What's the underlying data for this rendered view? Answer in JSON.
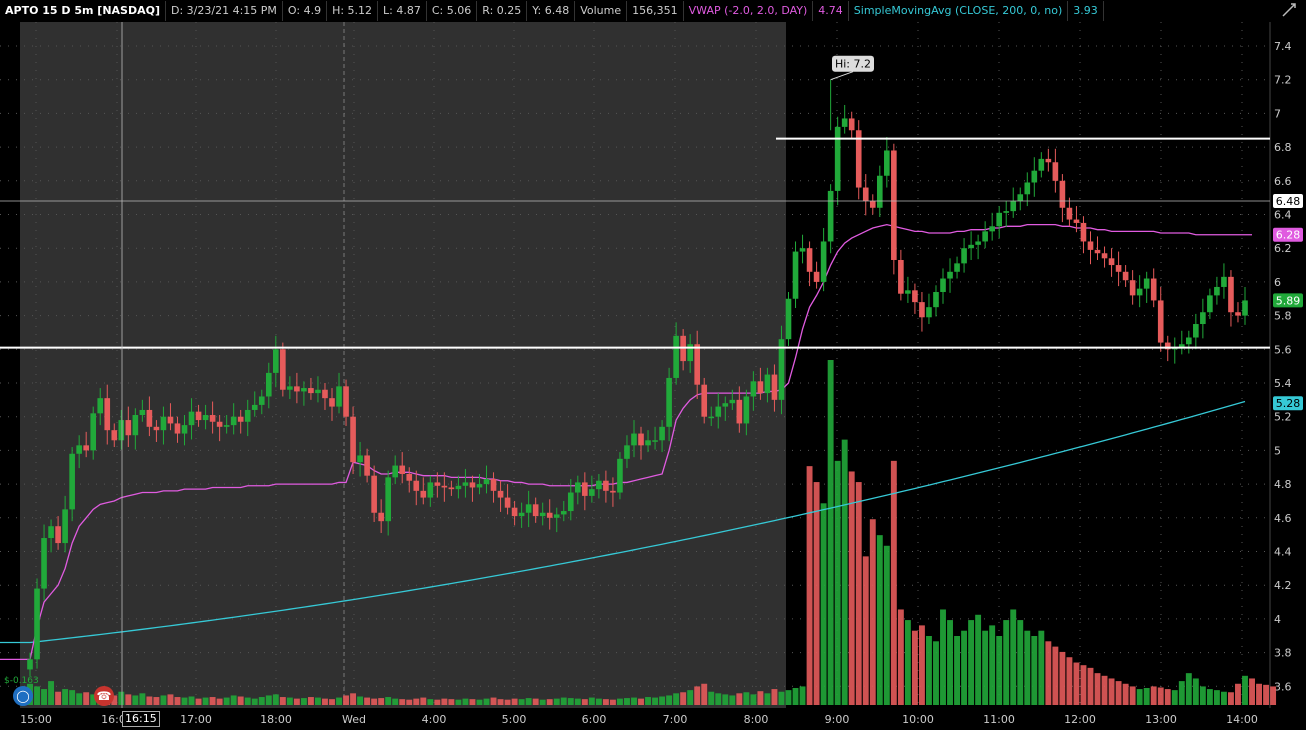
{
  "header": {
    "symbol": "APTO 15 D 5m [NASDAQ]",
    "date": "D: 3/23/21 4:15 PM",
    "open": "O: 4.9",
    "high": "H: 5.12",
    "low": "L: 4.87",
    "close": "C: 5.06",
    "range": "R: 0.25",
    "prev": "Y: 6.48",
    "volume_label": "Volume",
    "volume_value": "156,351",
    "vwap_label": "VWAP (-2.0, 2.0, DAY)",
    "vwap_value": "4.74",
    "sma_label": "SimpleMovingAvg (CLOSE, 200, 0, no)",
    "sma_value": "3.93"
  },
  "icons": {
    "tool": "draw-icon",
    "bulb": "lightbulb-icon",
    "phone": "phone-icon"
  },
  "cursor_time": "16:15",
  "hi_label": "Hi: 7.2",
  "low_marker": "$-0.163",
  "colors": {
    "up": "#21a93a",
    "down": "#e65b5b",
    "vwap": "#e05be0",
    "sma": "#36c9d6",
    "premarket_bg": "#303030",
    "grid": "#555555"
  },
  "chart_data": {
    "type": "candlestick",
    "ylim": [
      3.5,
      7.5
    ],
    "y_ticks": [
      "7.4",
      "7.2",
      "7",
      "6.8",
      "6.6",
      "6.4",
      "6.2",
      "6",
      "5.8",
      "5.6",
      "5.4",
      "5.2",
      "5",
      "4.8",
      "4.6",
      "4.4",
      "4.2",
      "4",
      "3.8",
      "3.6"
    ],
    "x_ticks": [
      "15:00",
      "16:00",
      "17:00",
      "18:00",
      "Wed",
      "4:00",
      "5:00",
      "6:00",
      "7:00",
      "8:00",
      "9:00",
      "10:00",
      "11:00",
      "12:00",
      "13:00",
      "14:00"
    ],
    "horizontal_lines": [
      6.85,
      5.61
    ],
    "crosshair_y": 6.48,
    "price_labels": [
      {
        "label": "6.48",
        "value": 6.48,
        "color": "#ffffff",
        "text_color": "#000000"
      },
      {
        "label": "6.28",
        "value": 6.28,
        "color": "#e05be0",
        "text_color": "#ffffff"
      },
      {
        "label": "5.89",
        "value": 5.89,
        "color": "#21a93a",
        "text_color": "#ffffff"
      },
      {
        "label": "5.28",
        "value": 5.28,
        "color": "#36c9d6",
        "text_color": "#000000"
      }
    ],
    "high": 7.2,
    "closes": [
      3.76,
      4.18,
      4.48,
      4.55,
      4.45,
      4.65,
      4.98,
      5.03,
      5.0,
      5.22,
      5.31,
      5.12,
      5.06,
      5.18,
      5.09,
      5.21,
      5.24,
      5.14,
      5.12,
      5.2,
      5.16,
      5.1,
      5.15,
      5.23,
      5.18,
      5.21,
      5.17,
      5.14,
      5.15,
      5.2,
      5.17,
      5.24,
      5.27,
      5.32,
      5.46,
      5.6,
      5.36,
      5.38,
      5.35,
      5.37,
      5.34,
      5.36,
      5.31,
      5.26,
      5.38,
      5.2,
      4.93,
      4.97,
      4.85,
      4.63,
      4.58,
      4.84,
      4.91,
      4.86,
      4.82,
      4.76,
      4.72,
      4.81,
      4.79,
      4.78,
      4.77,
      4.79,
      4.81,
      4.78,
      4.8,
      4.83,
      4.76,
      4.72,
      4.66,
      4.61,
      4.63,
      4.68,
      4.61,
      4.63,
      4.6,
      4.62,
      4.64,
      4.75,
      4.81,
      4.73,
      4.77,
      4.82,
      4.76,
      4.75,
      4.95,
      5.03,
      5.1,
      5.03,
      5.06,
      5.06,
      5.14,
      5.43,
      5.68,
      5.53,
      5.63,
      5.39,
      5.2,
      5.2,
      5.26,
      5.28,
      5.3,
      5.16,
      5.32,
      5.41,
      5.34,
      5.45,
      5.3,
      5.66,
      5.9,
      6.18,
      6.2,
      6.06,
      6.0,
      6.24,
      6.54,
      6.92,
      6.97,
      6.9,
      6.56,
      6.48,
      6.44,
      6.63,
      6.78,
      6.13,
      5.93,
      5.95,
      5.88,
      5.79,
      5.85,
      5.94,
      6.02,
      6.06,
      6.11,
      6.2,
      6.22,
      6.24,
      6.3,
      6.33,
      6.41,
      6.42,
      6.48,
      6.52,
      6.59,
      6.66,
      6.73,
      6.71,
      6.6,
      6.44,
      6.37,
      6.35,
      6.24,
      6.19,
      6.17,
      6.14,
      6.1,
      6.06,
      6.01,
      5.92,
      5.96,
      6.02,
      5.89,
      5.64,
      5.6,
      5.61,
      5.63,
      5.67,
      5.75,
      5.82,
      5.92,
      5.97,
      6.03,
      5.82,
      5.8,
      5.89
    ],
    "volumes": [
      40,
      35,
      30,
      45,
      25,
      30,
      28,
      22,
      24,
      20,
      22,
      26,
      18,
      25,
      20,
      18,
      22,
      16,
      15,
      18,
      20,
      15,
      14,
      16,
      12,
      14,
      15,
      12,
      14,
      18,
      16,
      14,
      12,
      15,
      18,
      20,
      15,
      14,
      12,
      13,
      15,
      14,
      12,
      11,
      14,
      18,
      22,
      16,
      14,
      12,
      13,
      15,
      12,
      11,
      10,
      12,
      14,
      11,
      10,
      12,
      11,
      10,
      12,
      11,
      10,
      12,
      14,
      11,
      10,
      12,
      11,
      13,
      12,
      10,
      11,
      12,
      14,
      13,
      12,
      11,
      14,
      12,
      11,
      10,
      12,
      13,
      14,
      12,
      15,
      14,
      16,
      18,
      22,
      24,
      28,
      35,
      40,
      25,
      22,
      20,
      18,
      22,
      24,
      20,
      26,
      22,
      30,
      25,
      28,
      32,
      35,
      450,
      420,
      380,
      650,
      460,
      500,
      440,
      420,
      280,
      350,
      320,
      300,
      460,
      180,
      160,
      140,
      150,
      130,
      120,
      180,
      160,
      130,
      140,
      160,
      170,
      140,
      150,
      130,
      160,
      180,
      160,
      140,
      130,
      140,
      120,
      110,
      100,
      90,
      80,
      75,
      70,
      60,
      55,
      50,
      45,
      40,
      35,
      30,
      32,
      35,
      33,
      30,
      28,
      45,
      60,
      50,
      35,
      30,
      28,
      25,
      24,
      40,
      55,
      50,
      40,
      38,
      35
    ],
    "vwap": [
      3.76,
      3.95,
      4.1,
      4.15,
      4.2,
      4.3,
      4.45,
      4.55,
      4.6,
      4.65,
      4.68,
      4.69,
      4.7,
      4.72,
      4.73,
      4.74,
      4.75,
      4.75,
      4.75,
      4.76,
      4.76,
      4.76,
      4.77,
      4.77,
      4.77,
      4.77,
      4.78,
      4.78,
      4.78,
      4.78,
      4.78,
      4.79,
      4.79,
      4.79,
      4.79,
      4.8,
      4.8,
      4.8,
      4.8,
      4.8,
      4.8,
      4.8,
      4.8,
      4.8,
      4.81,
      4.81,
      4.93,
      4.92,
      4.91,
      4.88,
      4.86,
      4.86,
      4.87,
      4.87,
      4.87,
      4.86,
      4.85,
      4.85,
      4.85,
      4.85,
      4.84,
      4.84,
      4.84,
      4.84,
      4.84,
      4.83,
      4.83,
      4.82,
      4.82,
      4.81,
      4.81,
      4.8,
      4.8,
      4.8,
      4.79,
      4.79,
      4.79,
      4.79,
      4.79,
      4.79,
      4.79,
      4.8,
      4.8,
      4.8,
      4.81,
      4.81,
      4.82,
      4.83,
      4.84,
      4.85,
      4.86,
      5.0,
      5.18,
      5.25,
      5.3,
      5.33,
      5.34,
      5.34,
      5.34,
      5.34,
      5.34,
      5.34,
      5.34,
      5.34,
      5.34,
      5.35,
      5.35,
      5.36,
      5.4,
      5.55,
      5.72,
      5.85,
      5.92,
      6.0,
      6.1,
      6.18,
      6.23,
      6.26,
      6.28,
      6.3,
      6.32,
      6.33,
      6.34,
      6.33,
      6.32,
      6.31,
      6.3,
      6.3,
      6.29,
      6.29,
      6.29,
      6.29,
      6.3,
      6.3,
      6.31,
      6.31,
      6.31,
      6.32,
      6.32,
      6.33,
      6.33,
      6.33,
      6.34,
      6.34,
      6.34,
      6.34,
      6.34,
      6.33,
      6.33,
      6.32,
      6.32,
      6.32,
      6.31,
      6.31,
      6.3,
      6.3,
      6.3,
      6.3,
      6.3,
      6.3,
      6.3,
      6.29,
      6.29,
      6.29,
      6.29,
      6.29,
      6.28,
      6.28,
      6.28,
      6.28,
      6.28,
      6.28,
      6.28,
      6.28,
      6.28
    ],
    "sma_start": 3.86,
    "sma_end": 5.29
  }
}
